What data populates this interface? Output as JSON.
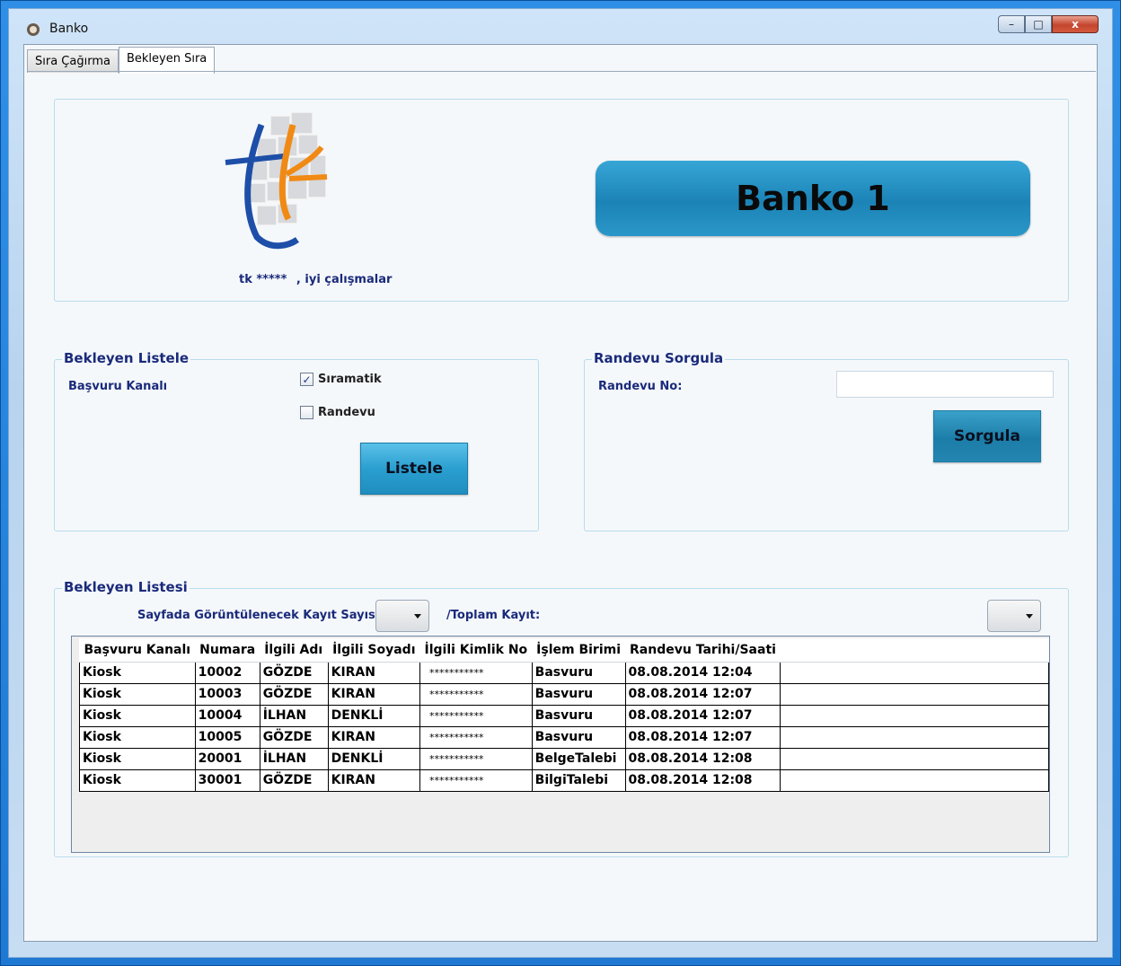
{
  "window": {
    "title": "Banko",
    "minimize": "–",
    "maximize": "□",
    "close": "x"
  },
  "tabs": [
    {
      "label": "Sıra Çağırma"
    },
    {
      "label": "Bekleyen Sıra"
    }
  ],
  "header": {
    "logo_text": "tk",
    "greeting_name": "tk *****",
    "greeting_suffix": ", iyi çalışmalar",
    "banko_label": "Banko 1"
  },
  "bekleyen_listele": {
    "title": "Bekleyen Listele",
    "channel_label": "Başvuru Kanalı",
    "options": [
      {
        "label": "Sıramatik",
        "checked": true
      },
      {
        "label": "Randevu",
        "checked": false
      }
    ],
    "button": "Listele"
  },
  "randevu_sorgula": {
    "title": "Randevu Sorgula",
    "field_label": "Randevu No:",
    "field_value": "",
    "button": "Sorgula"
  },
  "bekleyen_listesi": {
    "title": "Bekleyen Listesi",
    "page_size_label": "Sayfada Görüntülenecek Kayıt Sayısı:",
    "total_label": "/Toplam Kayıt:",
    "columns": [
      "Başvuru Kanalı",
      "Numara",
      "İlgili Adı",
      "İlgili Soyadı",
      "İlgili Kimlik No",
      "İşlem Birimi",
      "Randevu Tarihi/Saati"
    ],
    "rows": [
      [
        "Kiosk",
        "10002",
        "GÖZDE",
        "KIRAN",
        "***********",
        "Basvuru",
        "08.08.2014 12:04"
      ],
      [
        "Kiosk",
        "10003",
        "GÖZDE",
        "KIRAN",
        "***********",
        "Basvuru",
        "08.08.2014 12:07"
      ],
      [
        "Kiosk",
        "10004",
        "İLHAN",
        "DENKLİ",
        "***********",
        "Basvuru",
        "08.08.2014 12:07"
      ],
      [
        "Kiosk",
        "10005",
        "GÖZDE",
        "KIRAN",
        "***********",
        "Basvuru",
        "08.08.2014 12:07"
      ],
      [
        "Kiosk",
        "20001",
        "İLHAN",
        "DENKLİ",
        "***********",
        "BelgeTalebi",
        "08.08.2014 12:08"
      ],
      [
        "Kiosk",
        "30001",
        "GÖZDE",
        "KIRAN",
        "***********",
        "BilgiTalebi",
        "08.08.2014 12:08"
      ]
    ]
  },
  "colors": {
    "accent": "#2a9fd0",
    "label": "#1a2a7a",
    "frame": "#1f79d3",
    "logo_blue": "#1d4fa8",
    "logo_orange": "#f08a14"
  }
}
